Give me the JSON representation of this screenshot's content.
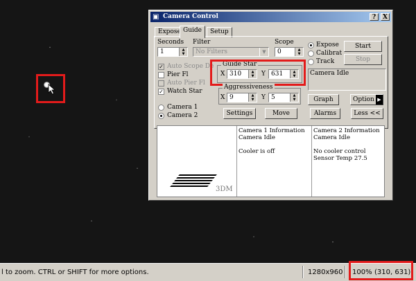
{
  "window": {
    "title": "Camera Control",
    "help_button": "?",
    "close_button": "X"
  },
  "tabs": [
    "Expose",
    "Guide",
    "Setup"
  ],
  "guide": {
    "seconds_label": "Seconds",
    "seconds_value": "1",
    "filter_label": "Filter",
    "filter_value": "No Filters",
    "scope_label": "Scope",
    "scope_value": "0",
    "mode_options": [
      "Expose",
      "Calibrat",
      "Track"
    ],
    "start_button": "Start",
    "stop_button": "Stop",
    "auto_scope_label": "Auto Scope De",
    "pier_flip_label": "Pier Fl",
    "auto_pier_flip_label": "Auto Pier Fl",
    "watch_star_label": "Watch Star",
    "guide_star_title": "Guide Star",
    "x_label": "X",
    "x_value": "310",
    "y_label": "Y",
    "y_value": "631",
    "aggressiveness_title": "Aggressiveness",
    "aggr_x_value": "9",
    "aggr_y_value": "5",
    "camera_idle": "Camera Idle",
    "camera1_label": "Camera 1",
    "camera2_label": "Camera 2",
    "graph_button": "Graph",
    "options_button": "Option",
    "settings_button": "Settings",
    "move_button": "Move",
    "alarms_button": "Alarms",
    "less_button": "Less <<"
  },
  "info": {
    "camera1": [
      "Camera 1 Information",
      "Camera Idle",
      "",
      "Cooler is off"
    ],
    "camera2": [
      "Camera 2 Information",
      "Camera Idle",
      "",
      "No cooler control",
      "Sensor Temp 27.5"
    ],
    "graphic_text": "3DM"
  },
  "statusbar": {
    "hint": "l to zoom. CTRL or SHIFT for more options.",
    "resolution": "1280x960",
    "zoom": "100%",
    "coords": "(310, 631)"
  },
  "colors": {
    "highlight": "#e31b1b",
    "titlebar": "#0a246a",
    "dialog": "#d4d0c8"
  }
}
